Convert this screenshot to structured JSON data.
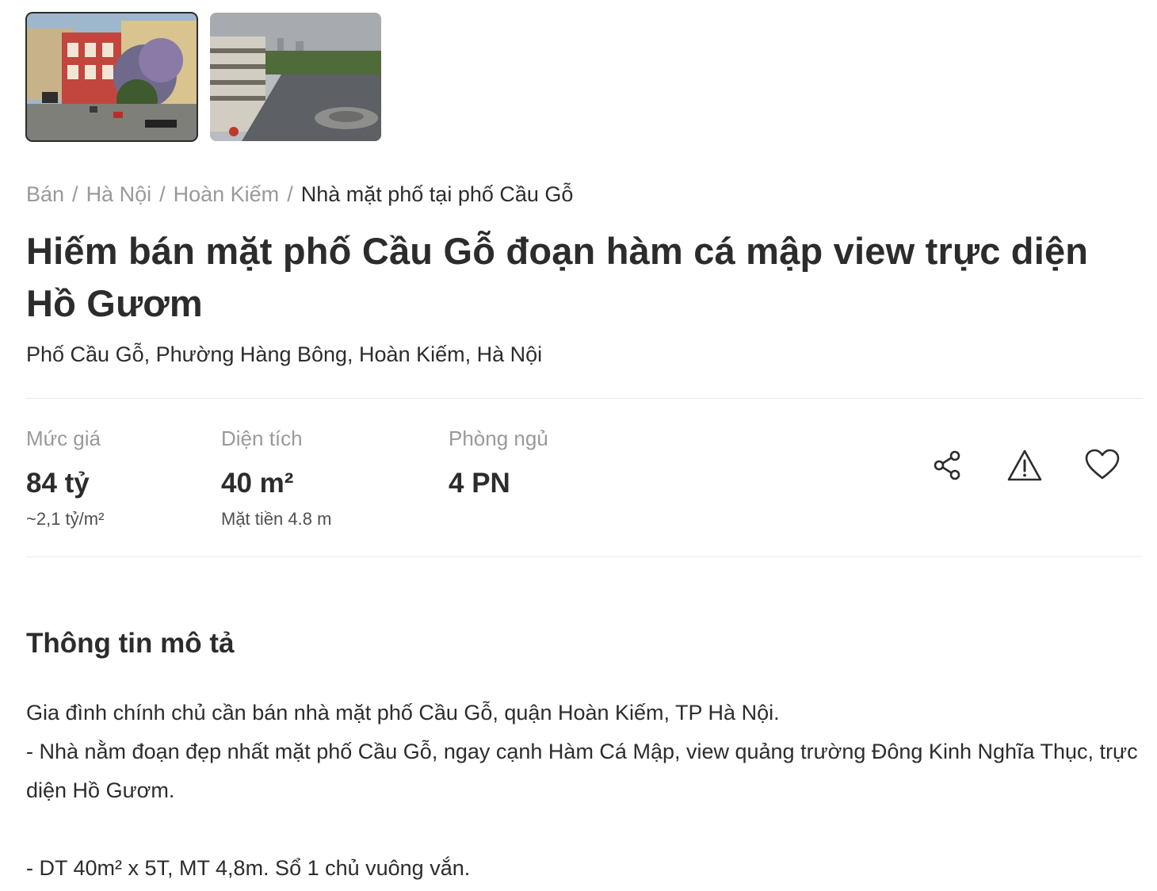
{
  "gallery": {
    "thumbnails": [
      {
        "label": "Street view of Cầu Gỗ houses",
        "selected": true
      },
      {
        "label": "Aerial view of Đông Kinh Nghĩa Thục square",
        "selected": false
      }
    ]
  },
  "breadcrumb": {
    "items": [
      "Bán",
      "Hà Nội",
      "Hoàn Kiếm"
    ],
    "current": "Nhà mặt phố tại phố Cầu Gỗ",
    "separator": "/"
  },
  "listing": {
    "title": "Hiếm bán mặt phố Cầu Gỗ đoạn hàm cá mập view trực diện Hồ Gươm",
    "address": "Phố Cầu Gỗ, Phường Hàng Bông, Hoàn Kiếm, Hà Nội"
  },
  "stats": {
    "price": {
      "label": "Mức giá",
      "value": "84 tỷ",
      "sub": "~2,1 tỷ/m²"
    },
    "area": {
      "label": "Diện tích",
      "value": "40 m²",
      "sub": "Mặt tiền 4.8 m"
    },
    "bedrooms": {
      "label": "Phòng ngủ",
      "value": "4 PN"
    }
  },
  "actions": {
    "icons": [
      "share-icon",
      "report-warning-icon",
      "heart-icon"
    ]
  },
  "description": {
    "heading": "Thông tin mô tả",
    "lines": [
      "Gia đình chính chủ cần bán nhà mặt phố Cầu Gỗ, quận Hoàn Kiếm, TP Hà Nội.",
      "- Nhà nằm đoạn đẹp nhất mặt phố Cầu Gỗ, ngay cạnh Hàm Cá Mập, view quảng trường Đông Kinh Nghĩa Thục, trực diện Hồ Gươm.",
      "",
      "- DT 40m² x 5T, MT 4,8m. Sổ 1 chủ vuông vắn."
    ]
  }
}
